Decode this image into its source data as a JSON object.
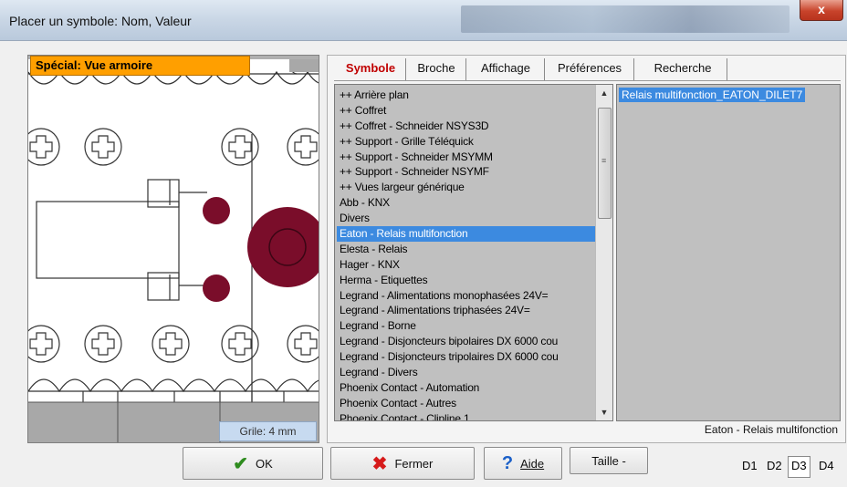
{
  "window": {
    "title": "Placer un symbole: Nom, Valeur",
    "close_label": "x"
  },
  "preview": {
    "special_label": "Spécial: Vue armoire",
    "grid_label": "Grile: 4 mm",
    "component_color": "#7a0d2a"
  },
  "tabs": [
    {
      "label": "Symbole",
      "active": true
    },
    {
      "label": "Broche",
      "active": false
    },
    {
      "label": "Affichage",
      "active": false
    },
    {
      "label": "Préférences",
      "active": false
    },
    {
      "label": "Recherche",
      "active": false
    }
  ],
  "category_list": {
    "items": [
      "++ Arrière plan",
      "++ Coffret",
      "++ Coffret - Schneider NSYS3D",
      "++ Support  - Grille Téléquick",
      "++ Support  - Schneider MSYMM",
      "++ Support  - Schneider NSYMF",
      "++ Vues largeur générique",
      "Abb - KNX",
      "Divers",
      "Eaton - Relais multifonction",
      "Elesta - Relais",
      "Hager - KNX",
      "Herma - Etiquettes",
      "Legrand - Alimentations monophasées 24V=",
      "Legrand - Alimentations triphasées 24V=",
      "Legrand - Borne",
      "Legrand - Disjoncteurs bipolaires DX 6000 cou",
      "Legrand - Disjoncteurs tripolaires DX 6000 cou",
      "Legrand - Divers",
      "Phoenix Contact - Automation",
      "Phoenix Contact - Autres",
      "Phoenix Contact - Clipline 1"
    ],
    "selected": "Eaton - Relais multifonction"
  },
  "symbol_list": {
    "items": [
      "Relais multifonction_EATON_DILET7"
    ],
    "selected": "Relais multifonction_EATON_DILET7"
  },
  "status": {
    "text": "Eaton - Relais multifonction"
  },
  "buttons": {
    "ok": {
      "label": "OK",
      "icon": "check-icon",
      "icon_color": "#2e8b1e"
    },
    "fermer": {
      "label": "Fermer",
      "icon": "x-icon",
      "icon_color": "#d61a1a"
    },
    "aide": {
      "label": "Aide",
      "icon": "question-icon",
      "icon_color": "#1a5fc8"
    },
    "taille": {
      "label": "Taille -"
    }
  },
  "display_buttons": [
    {
      "label": "D1",
      "active": false
    },
    {
      "label": "D2",
      "active": false
    },
    {
      "label": "D3",
      "active": true
    },
    {
      "label": "D4",
      "active": false
    }
  ]
}
